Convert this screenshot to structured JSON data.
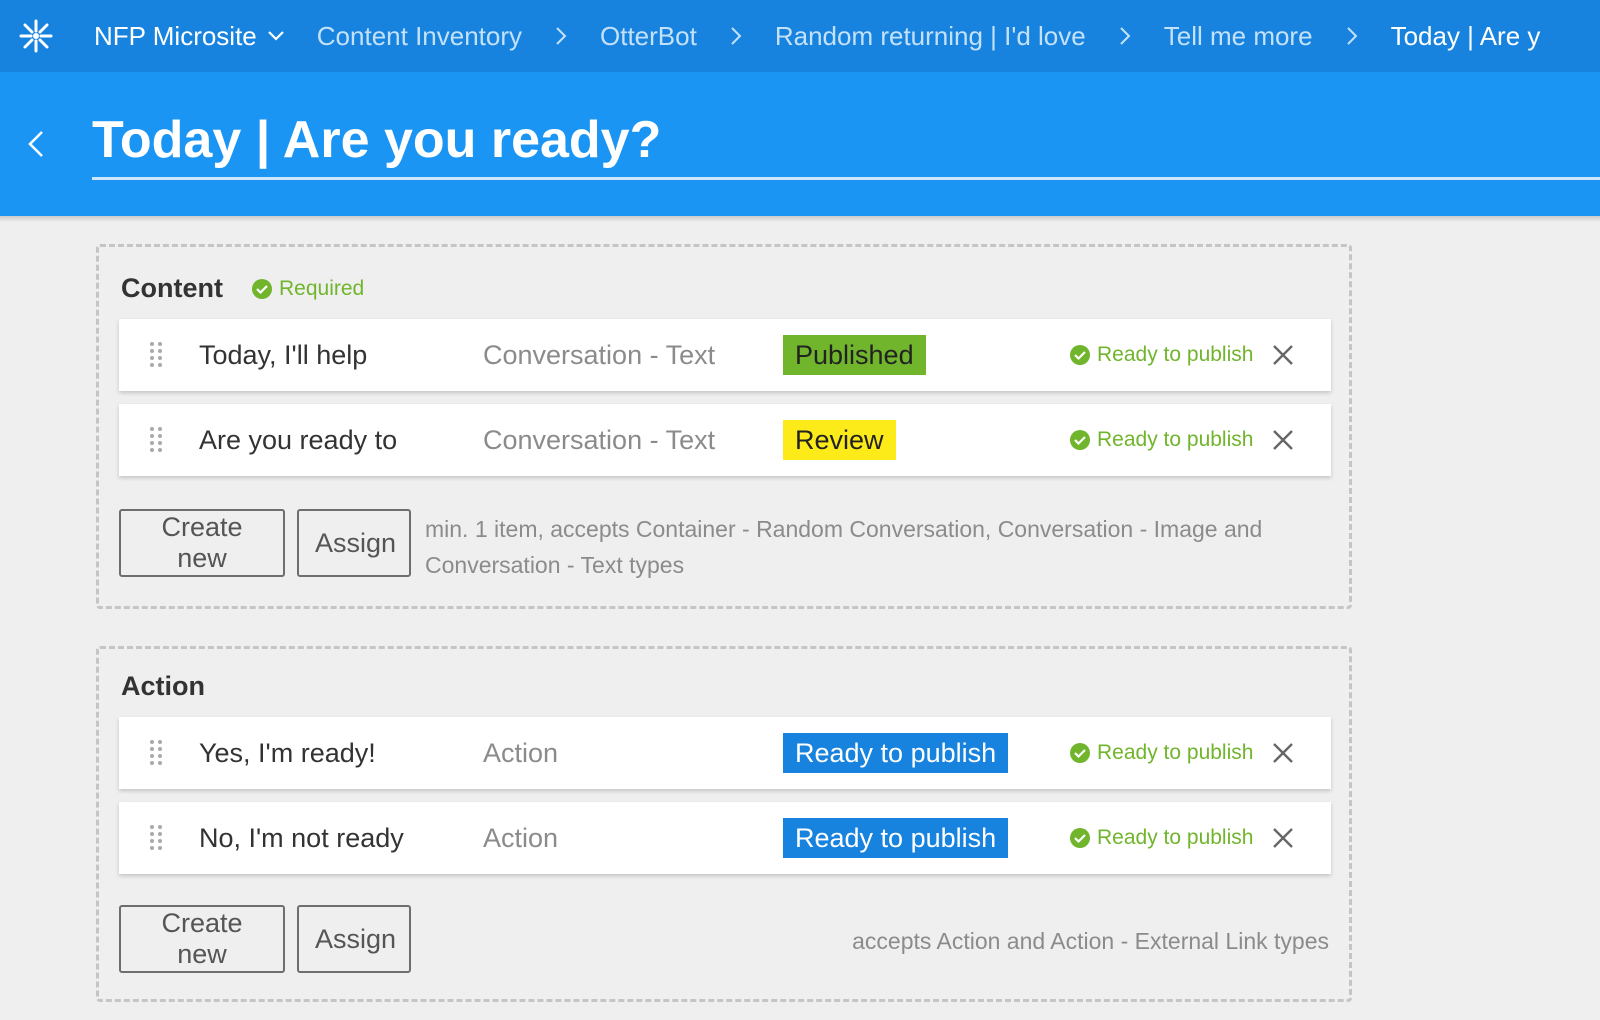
{
  "colors": {
    "nav_bg": "#1783de",
    "header_bg": "#1a95f3",
    "success_green": "#70b52c",
    "review_yellow": "#fcea19",
    "accent_blue": "#1783de"
  },
  "nav": {
    "logo_icon": "snowflake-icon",
    "project": "NFP Microsite",
    "breadcrumbs": [
      "Content Inventory",
      "OtterBot",
      "Random returning | I'd love",
      "Tell me more",
      "Today | Are y"
    ]
  },
  "header": {
    "title": "Today | Are you ready?"
  },
  "content_section": {
    "title": "Content",
    "required_label": "Required",
    "items": [
      {
        "name": "Today, I'll help",
        "type": "Conversation - Text",
        "badge": "Published",
        "status": "Ready to publish"
      },
      {
        "name": "Are you ready to",
        "type": "Conversation - Text",
        "badge": "Review",
        "status": "Ready to publish"
      }
    ],
    "create_label": "Create new",
    "assign_label": "Assign",
    "hint_line1": "min. 1 item, accepts Container - Random Conversation, Conversation - Image and",
    "hint_line2": "Conversation - Text types"
  },
  "action_section": {
    "title": "Action",
    "items": [
      {
        "name": "Yes, I'm ready!",
        "type": "Action",
        "badge": "Ready to publish",
        "status": "Ready to publish"
      },
      {
        "name": "No, I'm not ready",
        "type": "Action",
        "badge": "Ready to publish",
        "status": "Ready to publish"
      }
    ],
    "create_label": "Create new",
    "assign_label": "Assign",
    "hint": "accepts Action and Action - External Link types"
  }
}
